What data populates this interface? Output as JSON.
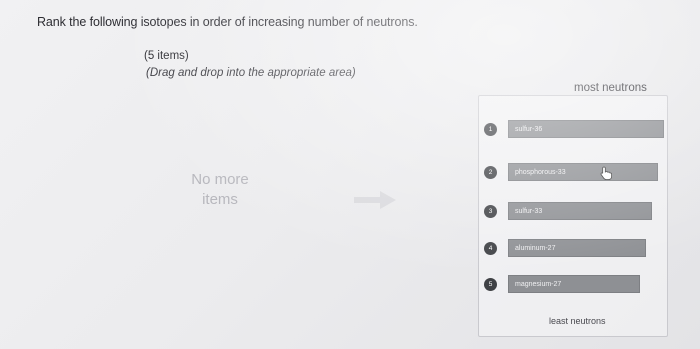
{
  "question": "Rank the following isotopes in order of increasing number of neutrons.",
  "items_count": "(5 items)",
  "instruction": "(Drag and drop into the appropriate area)",
  "source_area": {
    "line1": "No more",
    "line2": "items"
  },
  "ranking": {
    "top_label": "most neutrons",
    "bottom_label": "least neutrons",
    "items": [
      {
        "rank": "1",
        "label": "sulfur-36"
      },
      {
        "rank": "2",
        "label": "phosphorous-33"
      },
      {
        "rank": "3",
        "label": "sulfur-33"
      },
      {
        "rank": "4",
        "label": "aluminum-27"
      },
      {
        "rank": "5",
        "label": "magnesium-27"
      }
    ]
  },
  "icons": {
    "arrow": "arrow-right-icon",
    "cursor": "hand-cursor-icon"
  }
}
